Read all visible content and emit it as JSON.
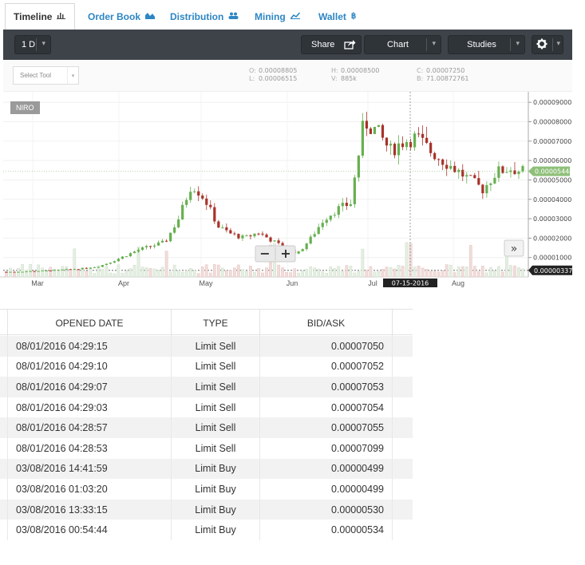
{
  "tabs": [
    {
      "label": "Timeline",
      "icon": "bar-chart-icon",
      "active": true
    },
    {
      "label": "Order Book",
      "icon": "area-chart-icon",
      "active": false
    },
    {
      "label": "Distribution",
      "icon": "users-icon",
      "active": false
    },
    {
      "label": "Mining",
      "icon": "line-chart-icon",
      "active": false
    },
    {
      "label": "Wallet",
      "icon": "bitcoin-icon",
      "active": false
    }
  ],
  "toolbar": {
    "interval": "1 D",
    "share": "Share",
    "chart": "Chart",
    "studies": "Studies"
  },
  "tool_select": {
    "label": "Select Tool"
  },
  "ohlc": {
    "o_label": "O:",
    "o": "0.00008805",
    "h_label": "H:",
    "h": "0.00008500",
    "c_label": "C:",
    "c": "0.00007250",
    "l_label": "L:",
    "l": "0.00006515",
    "v_label": "V:",
    "v": "885k",
    "b_label": "B:",
    "b": "71.00872761"
  },
  "chart_data": {
    "type": "candlestick",
    "symbol": "NIRO",
    "y_axis_labels": [
      "0.00009000",
      "0.00008000",
      "0.00007000",
      "0.00006000",
      "0.00005000",
      "0.00004000",
      "0.00003000",
      "0.00002000",
      "0.00001000"
    ],
    "ylim": [
      0,
      9.05e-05
    ],
    "x_axis_labels": [
      "Mar",
      "Apr",
      "May",
      "Jun",
      "Jul",
      "Aug"
    ],
    "crosshair_date": "07-15-2016",
    "current_price": "0.00005444",
    "baseline_price": "0.00000337",
    "approx_close_series": [
      2.6e-06,
      2.7e-06,
      3e-06,
      3.2e-06,
      3.6e-06,
      4e-06,
      4.5e-06,
      5.5e-06,
      8e-06,
      1.1e-05,
      1.4e-05,
      1.6e-05,
      1.8e-05,
      3e-05,
      4.8e-05,
      4e-05,
      2.6e-05,
      2.2e-05,
      2e-05,
      2.3e-05,
      1.9e-05,
      1.5e-05,
      1.2e-05,
      2e-05,
      3e-05,
      3.5e-05,
      3.8e-05,
      8e-05,
      7.5e-05,
      6.5e-05,
      7e-05,
      7.2e-05,
      6.5e-05,
      6e-05,
      5.5e-05,
      5e-05,
      4.5e-05,
      5.4e-05,
      5.6e-05,
      5.44e-05
    ],
    "zoom_out": "−",
    "zoom_in": "+",
    "scroll_right": "»"
  },
  "table": {
    "headers": [
      "OPENED DATE",
      "TYPE",
      "BID/ASK"
    ],
    "rows": [
      {
        "date": "08/01/2016 04:29:15",
        "type": "Limit Sell",
        "price": "0.00007050"
      },
      {
        "date": "08/01/2016 04:29:10",
        "type": "Limit Sell",
        "price": "0.00007052"
      },
      {
        "date": "08/01/2016 04:29:07",
        "type": "Limit Sell",
        "price": "0.00007053"
      },
      {
        "date": "08/01/2016 04:29:03",
        "type": "Limit Sell",
        "price": "0.00007054"
      },
      {
        "date": "08/01/2016 04:28:57",
        "type": "Limit Sell",
        "price": "0.00007055"
      },
      {
        "date": "08/01/2016 04:28:53",
        "type": "Limit Sell",
        "price": "0.00007099"
      },
      {
        "date": "03/08/2016 14:41:59",
        "type": "Limit Buy",
        "price": "0.00000499"
      },
      {
        "date": "03/08/2016 01:03:20",
        "type": "Limit Buy",
        "price": "0.00000499"
      },
      {
        "date": "03/08/2016 13:33:15",
        "type": "Limit Buy",
        "price": "0.00000530"
      },
      {
        "date": "03/08/2016 00:54:44",
        "type": "Limit Buy",
        "price": "0.00000534"
      }
    ]
  },
  "colors": {
    "up": "#66b050",
    "down": "#a8322a",
    "accent": "#2d86c4",
    "toolbar_bg": "#3d4349",
    "price_tag": "#8fc07a"
  }
}
